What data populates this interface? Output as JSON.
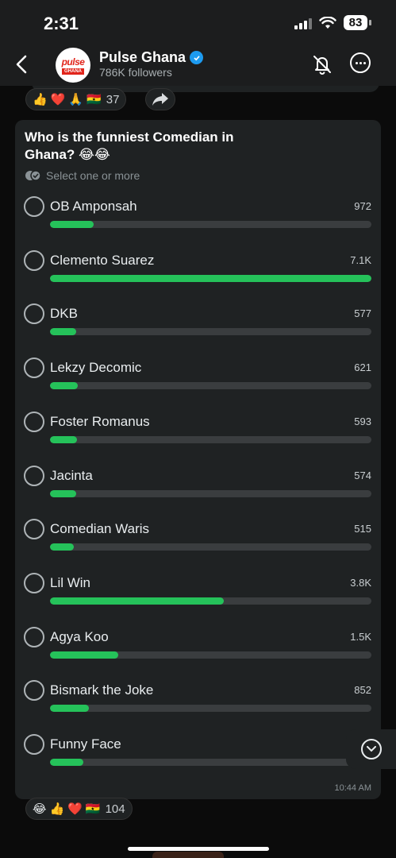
{
  "status_bar": {
    "time": "2:31",
    "battery": "83"
  },
  "header": {
    "channel_name": "Pulse Ghana",
    "followers": "786K followers",
    "avatar_top": "pulse",
    "avatar_bottom": "GHANA"
  },
  "previous_message": {
    "reactions": {
      "emojis": [
        "👍",
        "❤️",
        "🙏",
        "🇬🇭"
      ],
      "count": "37"
    }
  },
  "poll": {
    "question": "Who is the funniest Comedian in Ghana? 😂😂",
    "hint": "Select one or more",
    "options": [
      {
        "label": "OB Amponsah",
        "count": "972",
        "fill": 0.137
      },
      {
        "label": "Clemento Suarez",
        "count": "7.1K",
        "fill": 1.0
      },
      {
        "label": "DKB",
        "count": "577",
        "fill": 0.081
      },
      {
        "label": "Lekzy Decomic",
        "count": "621",
        "fill": 0.087
      },
      {
        "label": "Foster Romanus",
        "count": "593",
        "fill": 0.084
      },
      {
        "label": "Jacinta",
        "count": "574",
        "fill": 0.081
      },
      {
        "label": "Comedian Waris",
        "count": "515",
        "fill": 0.073
      },
      {
        "label": "Lil Win",
        "count": "3.8K",
        "fill": 0.54
      },
      {
        "label": "Agya Koo",
        "count": "1.5K",
        "fill": 0.213
      },
      {
        "label": "Bismark the Joke",
        "count": "852",
        "fill": 0.12
      },
      {
        "label": "Funny Face",
        "count": "",
        "fill": 0.104
      }
    ],
    "time": "10:44 AM",
    "reactions": {
      "emojis": [
        "😂",
        "👍",
        "❤️",
        "🇬🇭"
      ],
      "count": "104"
    }
  },
  "colors": {
    "accent": "#25c25a",
    "bubble": "#1f2223",
    "background": "#0b0b0b",
    "verified": "#1d9bf0"
  },
  "icons": [
    "back-chevron-icon",
    "verified-badge-icon",
    "bell-muted-icon",
    "more-options-icon",
    "forward-icon",
    "multi-select-check-icon",
    "scroll-down-icon"
  ]
}
